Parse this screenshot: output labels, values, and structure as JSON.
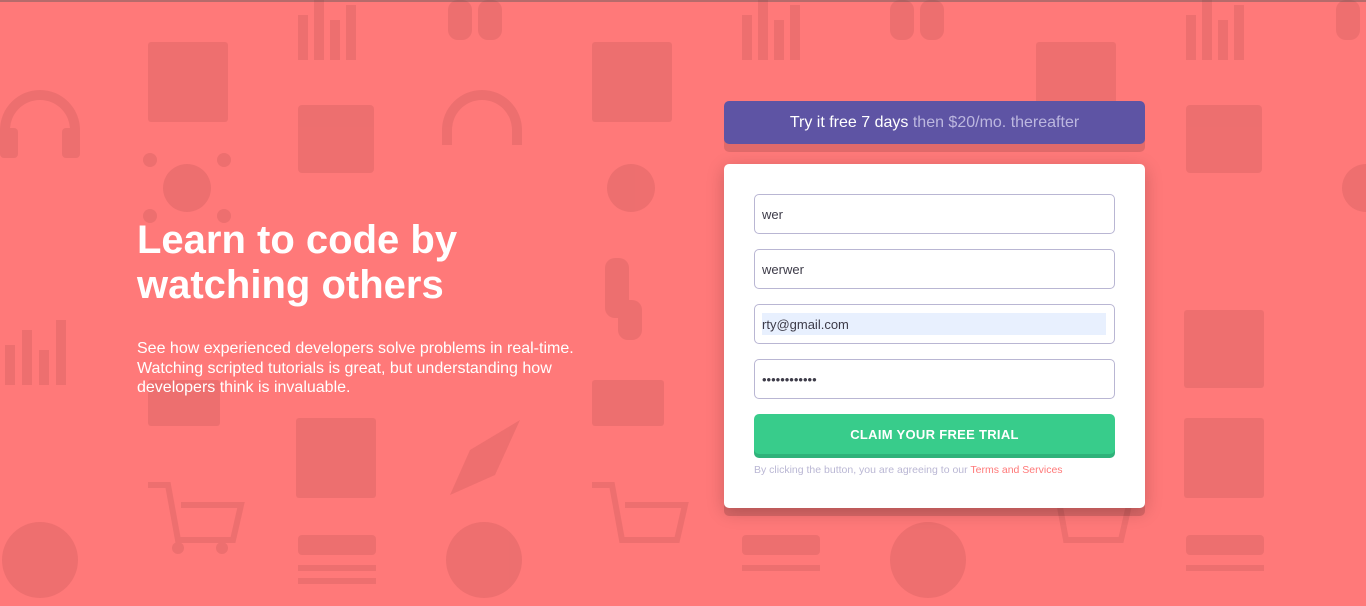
{
  "hero": {
    "title": "Learn to code by watching others",
    "description": "See how experienced developers solve problems in real-time. Watching scripted tutorials is great, but understanding how developers think is invaluable."
  },
  "promo": {
    "strong": "Try it free 7 days",
    "muted": "then $20/mo. thereafter"
  },
  "form": {
    "first_name": "wer",
    "last_name": "werwer",
    "email": "rty@gmail.com",
    "password": "wersdfsdfsdf",
    "submit_label": "CLAIM YOUR FREE TRIAL",
    "terms_prefix": "By clicking the button, you are agreeing to our ",
    "terms_link": "Terms and Services"
  },
  "colors": {
    "background": "#ff7979",
    "promo": "#5e54a4",
    "cta": "#38cc8b"
  },
  "background_icons": [
    "bar-chart-icon",
    "browser-window-icon",
    "headset-icon",
    "toolbox-icon",
    "network-icon",
    "thumbs-up-icon",
    "link-icon",
    "rocket-icon",
    "magnifier-icon",
    "cart-icon",
    "globe-gear-icon",
    "key-icon",
    "pencil-doc-icon",
    "folder-gear-icon"
  ]
}
